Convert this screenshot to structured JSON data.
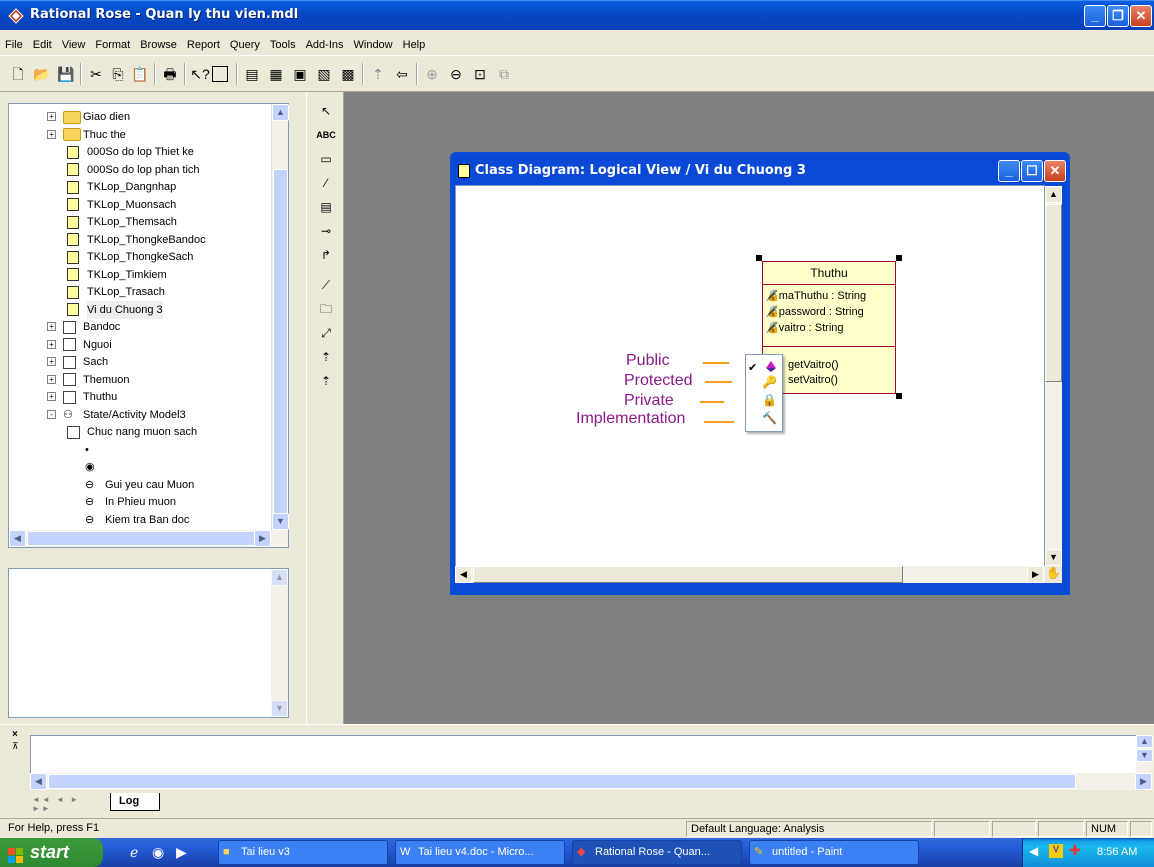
{
  "window": {
    "title": "Rational Rose - Quan ly thu vien.mdl"
  },
  "menu": [
    "File",
    "Edit",
    "View",
    "Format",
    "Browse",
    "Report",
    "Query",
    "Tools",
    "Add-Ins",
    "Window",
    "Help"
  ],
  "tree": {
    "items": [
      {
        "label": "Giao dien",
        "kind": "folder",
        "expander": "+"
      },
      {
        "label": "Thuc the",
        "kind": "folder",
        "expander": "+"
      },
      {
        "label": "000So do lop Thiet ke",
        "kind": "diagram"
      },
      {
        "label": "000So do lop phan tich",
        "kind": "diagram"
      },
      {
        "label": "TKLop_Dangnhap",
        "kind": "diagram"
      },
      {
        "label": "TKLop_Muonsach",
        "kind": "diagram"
      },
      {
        "label": "TKLop_Themsach",
        "kind": "diagram"
      },
      {
        "label": "TKLop_ThongkeBandoc",
        "kind": "diagram"
      },
      {
        "label": "TKLop_ThongkeSach",
        "kind": "diagram"
      },
      {
        "label": "TKLop_Timkiem",
        "kind": "diagram"
      },
      {
        "label": "TKLop_Trasach",
        "kind": "diagram"
      },
      {
        "label": "Vi du Chuong 3",
        "kind": "diagram"
      },
      {
        "label": "Bandoc",
        "kind": "class",
        "expander": "+"
      },
      {
        "label": "Nguoi",
        "kind": "class",
        "expander": "+"
      },
      {
        "label": "Sach",
        "kind": "class",
        "expander": "+"
      },
      {
        "label": "Themuon",
        "kind": "class",
        "expander": "+"
      },
      {
        "label": "Thuthu",
        "kind": "class",
        "expander": "+"
      },
      {
        "label": "State/Activity Model3",
        "kind": "state",
        "expander": "-"
      },
      {
        "label": "Chuc nang muon sach",
        "kind": "activity"
      },
      {
        "label": "",
        "kind": "dot"
      },
      {
        "label": "",
        "kind": "enddot"
      },
      {
        "label": "Gui yeu cau Muon",
        "kind": "activity-state"
      },
      {
        "label": "In Phieu muon",
        "kind": "activity-state"
      },
      {
        "label": "Kiem tra Ban doc",
        "kind": "activity-state"
      }
    ]
  },
  "palette": {
    "text_tool": "ABC"
  },
  "diagram_window": {
    "title": "Class Diagram: Logical View / Vi du Chuong 3"
  },
  "class_box": {
    "name": "Thuthu",
    "attributes": [
      "maThuthu : String",
      "password : String",
      "vaitro : String"
    ],
    "operations": [
      "getVaitro()",
      "setVaitro()"
    ]
  },
  "visibility_labels": {
    "public": "Public",
    "protected": "Protected",
    "private": "Private",
    "implementation": "Implementation"
  },
  "log": {
    "tab": "Log"
  },
  "status": {
    "help": "For Help, press F1",
    "language": "Default Language: Analysis",
    "num": "NUM"
  },
  "taskbar": {
    "start": "start",
    "tasks": [
      "Tai lieu v3",
      "Tai lieu v4.doc - Micro...",
      "Rational Rose - Quan...",
      "untitled - Paint"
    ],
    "clock": "8:56 AM"
  },
  "colors": {
    "accent": "#0a49d6",
    "label_purple": "#8b1a8b",
    "leader_orange": "#f59b1d",
    "class_fill": "#ffffcc",
    "class_border": "#990033"
  }
}
